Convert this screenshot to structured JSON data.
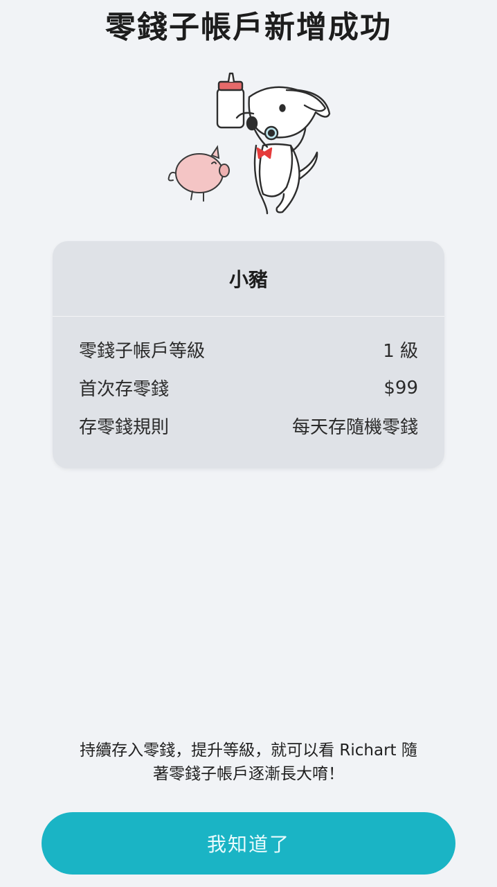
{
  "header": {
    "title": "零錢子帳戶新增成功"
  },
  "card": {
    "name": "小豬",
    "rows": [
      {
        "label": "零錢子帳戶等級",
        "value": "1 級"
      },
      {
        "label": "首次存零錢",
        "value": "$99"
      },
      {
        "label": "存零錢規則",
        "value": "每天存隨機零錢"
      }
    ]
  },
  "footer": {
    "note_line1": "持續存入零錢，提升等級，就可以看 Richart 隨",
    "note_line2": "著零錢子帳戶逐漸長大唷！"
  },
  "actions": {
    "confirm_label": "我知道了"
  },
  "colors": {
    "background": "#f1f3f6",
    "card": "#dfe2e7",
    "accent": "#1ab4c5"
  }
}
